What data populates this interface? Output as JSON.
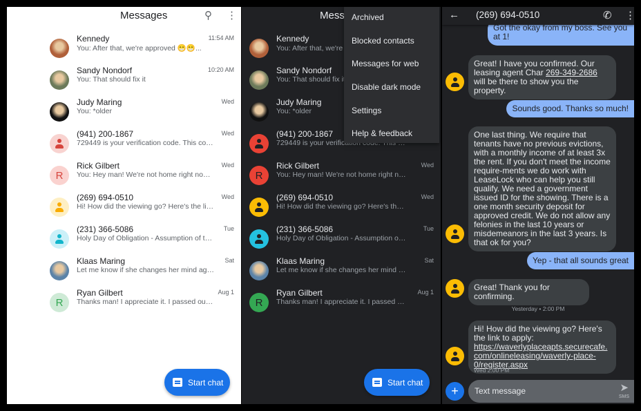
{
  "light": {
    "title": "Messages",
    "start_chat": "Start chat"
  },
  "dark": {
    "title": "Messages",
    "start_chat": "Start chat",
    "menu": [
      "Archived",
      "Blocked contacts",
      "Messages for web",
      "Disable dark mode",
      "Settings",
      "Help & feedback"
    ]
  },
  "conversations": [
    {
      "name": "Kennedy",
      "preview": "You: After that, we're approved 😁😁...",
      "time": "11:54 AM",
      "avatar": "photo",
      "light_bg": "#b0603a",
      "dark_bg": "#b0603a"
    },
    {
      "name": "Sandy Nondorf",
      "preview": "You: That should fix it",
      "time": "10:20 AM",
      "avatar": "photo",
      "light_bg": "#6c7a5a",
      "dark_bg": "#6c7a5a"
    },
    {
      "name": "Judy Maring",
      "preview": "You: *older",
      "time": "Wed",
      "avatar": "photo",
      "light_bg": "#111111",
      "dark_bg": "#111111"
    },
    {
      "name": "(941) 200-1867",
      "preview": "729449 is your verification code. This code ...",
      "time": "Wed",
      "avatar": "person",
      "light_bg": "#f8d3d0",
      "light_fg": "#d6453d",
      "dark_bg": "#e94235",
      "dark_fg": "#202124"
    },
    {
      "name": "Rick Gilbert",
      "preview": "You: Hey man! We're not home right now bu...",
      "time": "Wed",
      "avatar": "letter",
      "letter": "R",
      "light_bg": "#fad2cf",
      "light_fg": "#d6453d",
      "dark_bg": "#e94235",
      "dark_fg": "#202124"
    },
    {
      "name": "(269) 694-0510",
      "preview": "Hi! How did the viewing go? Here's the link t...",
      "time": "Wed",
      "avatar": "person",
      "light_bg": "#feefc3",
      "light_fg": "#f9ab00",
      "dark_bg": "#fbbc04",
      "dark_fg": "#202124"
    },
    {
      "name": "(231) 366-5086",
      "preview": "Holy Day of Obligation - Assumption of the B...",
      "time": "Tue",
      "avatar": "person",
      "light_bg": "#cbf0f8",
      "light_fg": "#12b5cb",
      "dark_bg": "#24c1e0",
      "dark_fg": "#202124"
    },
    {
      "name": "Klaas Maring",
      "preview": "Let me know if she changes her mind again",
      "time": "Sat",
      "avatar": "photo",
      "light_bg": "#5b83a8",
      "dark_bg": "#5b83a8"
    },
    {
      "name": "Ryan Gilbert",
      "preview": "Thanks man! I appreciate it. I passed out e...",
      "time": "Aug 1",
      "avatar": "letter",
      "letter": "R",
      "light_bg": "#ceead6",
      "light_fg": "#34a853",
      "dark_bg": "#34a853",
      "dark_fg": "#202124"
    }
  ],
  "thread": {
    "title": "(269) 694-0510",
    "messages": [
      {
        "dir": "out",
        "text": "Got the okay from my boss. See you at 1!"
      },
      {
        "dir": "in",
        "parts": [
          "Great! I have you confirmed. Our leasing agent Char ",
          {
            "link": "269-349-2686"
          },
          " will be there to show you the property."
        ]
      },
      {
        "dir": "out",
        "text": "Sounds good. Thanks so much!"
      },
      {
        "dir": "in",
        "text": "One last thing. We require that tenants have no previous evictions, with a monthly income of at least 3x the rent. If you don't meet the income require-ments we do work with LeaseLock who can help you still qualify. We need a government issued ID for the showing. There is a one month security deposit for approved credit. We do not allow any felonies in the last 10 years or misdemeanors in the last 3 years. Is that ok for you?"
      },
      {
        "dir": "out",
        "text": "Yep - that all sounds great"
      },
      {
        "dir": "in",
        "text": "Great! Thank you for confirming."
      },
      {
        "dir": "in",
        "parts": [
          "Hi! How did the viewing go? Here's the link to apply: ",
          {
            "link": "https://waverlyplaceapts.securecafe.com/onlineleasing/waverly-place-0/register.aspx"
          }
        ]
      }
    ],
    "date_divider": "Yesterday • 2:00 PM",
    "last_timestamp": "Wed 2:00 PM",
    "input_placeholder": "Text message",
    "send_label": "SMS"
  },
  "colors": {
    "accent": "#1a73e8",
    "outgoing_bubble": "#8ab4f8",
    "incoming_bubble": "#3c4043",
    "dark_bg": "#202124"
  }
}
